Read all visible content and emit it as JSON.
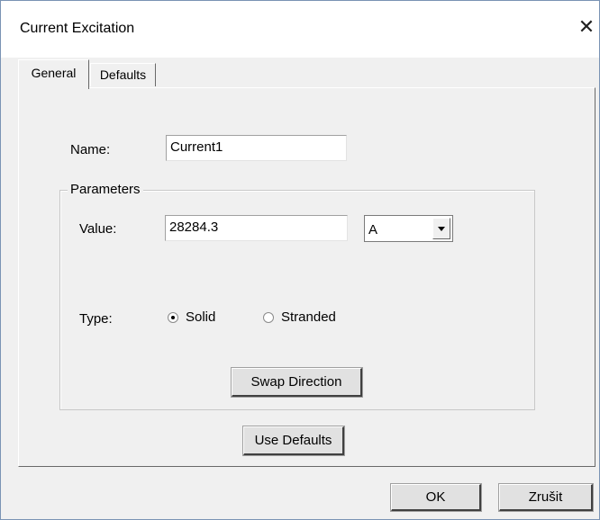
{
  "window": {
    "title": "Current Excitation",
    "close_glyph": "✕"
  },
  "tabs": [
    {
      "label": "General",
      "selected": true
    },
    {
      "label": "Defaults",
      "selected": false
    }
  ],
  "form": {
    "name_label": "Name:",
    "name_value": "Current1",
    "parameters": {
      "legend": "Parameters",
      "value_label": "Value:",
      "value_value": "28284.3",
      "unit_selected": "A",
      "type_label": "Type:",
      "type_options": [
        {
          "label": "Solid",
          "checked": true
        },
        {
          "label": "Stranded",
          "checked": false
        }
      ],
      "swap_direction_label": "Swap Direction"
    },
    "use_defaults_label": "Use Defaults"
  },
  "footer": {
    "ok_label": "OK",
    "cancel_label": "Zrušit"
  }
}
